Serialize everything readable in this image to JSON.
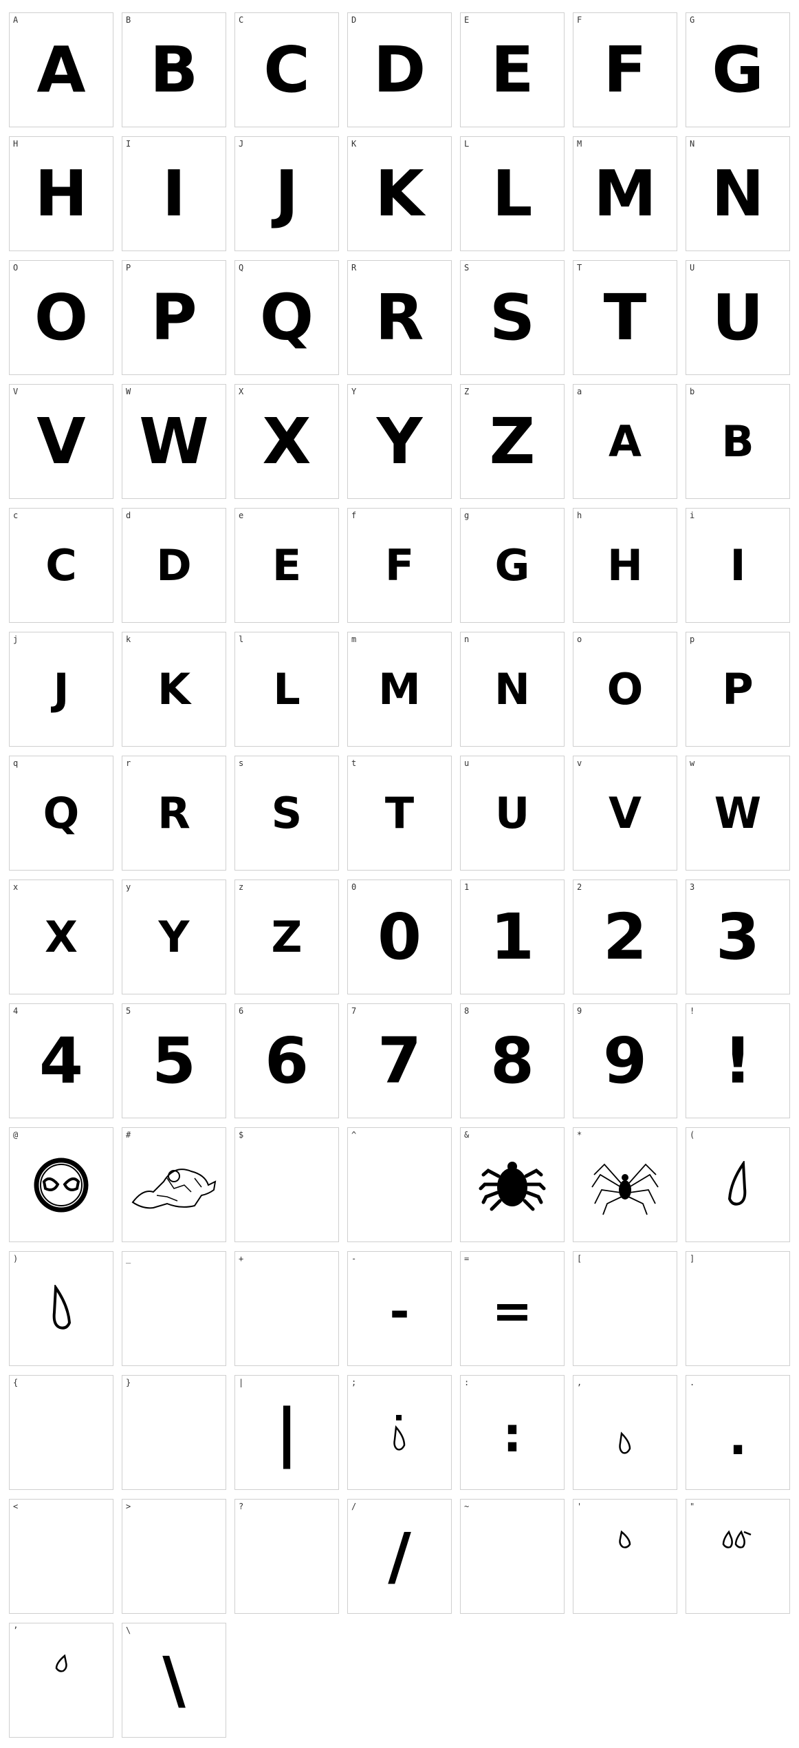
{
  "glyphs": [
    {
      "key": "A",
      "glyph": "A",
      "size": "big"
    },
    {
      "key": "B",
      "glyph": "B",
      "size": "big"
    },
    {
      "key": "C",
      "glyph": "C",
      "size": "big"
    },
    {
      "key": "D",
      "glyph": "D",
      "size": "big"
    },
    {
      "key": "E",
      "glyph": "E",
      "size": "big"
    },
    {
      "key": "F",
      "glyph": "F",
      "size": "big"
    },
    {
      "key": "G",
      "glyph": "G",
      "size": "big"
    },
    {
      "key": "H",
      "glyph": "H",
      "size": "big"
    },
    {
      "key": "I",
      "glyph": "I",
      "size": "big"
    },
    {
      "key": "J",
      "glyph": "J",
      "size": "big"
    },
    {
      "key": "K",
      "glyph": "K",
      "size": "big"
    },
    {
      "key": "L",
      "glyph": "L",
      "size": "big"
    },
    {
      "key": "M",
      "glyph": "M",
      "size": "big"
    },
    {
      "key": "N",
      "glyph": "N",
      "size": "big"
    },
    {
      "key": "O",
      "glyph": "O",
      "size": "big"
    },
    {
      "key": "P",
      "glyph": "P",
      "size": "big"
    },
    {
      "key": "Q",
      "glyph": "Q",
      "size": "big"
    },
    {
      "key": "R",
      "glyph": "R",
      "size": "big"
    },
    {
      "key": "S",
      "glyph": "S",
      "size": "big"
    },
    {
      "key": "T",
      "glyph": "T",
      "size": "big"
    },
    {
      "key": "U",
      "glyph": "U",
      "size": "big"
    },
    {
      "key": "V",
      "glyph": "V",
      "size": "big"
    },
    {
      "key": "W",
      "glyph": "W",
      "size": "big"
    },
    {
      "key": "X",
      "glyph": "X",
      "size": "big"
    },
    {
      "key": "Y",
      "glyph": "Y",
      "size": "big"
    },
    {
      "key": "Z",
      "glyph": "Z",
      "size": "big"
    },
    {
      "key": "a",
      "glyph": "A",
      "size": "small"
    },
    {
      "key": "b",
      "glyph": "B",
      "size": "small"
    },
    {
      "key": "c",
      "glyph": "C",
      "size": "small"
    },
    {
      "key": "d",
      "glyph": "D",
      "size": "small"
    },
    {
      "key": "e",
      "glyph": "E",
      "size": "small"
    },
    {
      "key": "f",
      "glyph": "F",
      "size": "small"
    },
    {
      "key": "g",
      "glyph": "G",
      "size": "small"
    },
    {
      "key": "h",
      "glyph": "H",
      "size": "small"
    },
    {
      "key": "i",
      "glyph": "I",
      "size": "small"
    },
    {
      "key": "j",
      "glyph": "J",
      "size": "small"
    },
    {
      "key": "k",
      "glyph": "K",
      "size": "small"
    },
    {
      "key": "l",
      "glyph": "L",
      "size": "small"
    },
    {
      "key": "m",
      "glyph": "M",
      "size": "small"
    },
    {
      "key": "n",
      "glyph": "N",
      "size": "small"
    },
    {
      "key": "o",
      "glyph": "O",
      "size": "small"
    },
    {
      "key": "p",
      "glyph": "P",
      "size": "small"
    },
    {
      "key": "q",
      "glyph": "Q",
      "size": "small"
    },
    {
      "key": "r",
      "glyph": "R",
      "size": "small"
    },
    {
      "key": "s",
      "glyph": "S",
      "size": "small"
    },
    {
      "key": "t",
      "glyph": "T",
      "size": "small"
    },
    {
      "key": "u",
      "glyph": "U",
      "size": "small"
    },
    {
      "key": "v",
      "glyph": "V",
      "size": "small"
    },
    {
      "key": "w",
      "glyph": "W",
      "size": "small"
    },
    {
      "key": "x",
      "glyph": "X",
      "size": "small"
    },
    {
      "key": "y",
      "glyph": "Y",
      "size": "small"
    },
    {
      "key": "z",
      "glyph": "Z",
      "size": "small"
    },
    {
      "key": "0",
      "glyph": "0",
      "size": "big"
    },
    {
      "key": "1",
      "glyph": "1",
      "size": "big"
    },
    {
      "key": "2",
      "glyph": "2",
      "size": "big"
    },
    {
      "key": "3",
      "glyph": "3",
      "size": "big"
    },
    {
      "key": "4",
      "glyph": "4",
      "size": "big"
    },
    {
      "key": "5",
      "glyph": "5",
      "size": "big"
    },
    {
      "key": "6",
      "glyph": "6",
      "size": "big"
    },
    {
      "key": "7",
      "glyph": "7",
      "size": "big"
    },
    {
      "key": "8",
      "glyph": "8",
      "size": "big"
    },
    {
      "key": "9",
      "glyph": "9",
      "size": "big"
    },
    {
      "key": "!",
      "glyph": "!",
      "size": "big"
    },
    {
      "key": "@",
      "glyph": "",
      "icon": "spider-mask-icon"
    },
    {
      "key": "#",
      "glyph": "",
      "icon": "crouching-figure-icon"
    },
    {
      "key": "$",
      "glyph": "",
      "icon": ""
    },
    {
      "key": "^",
      "glyph": "",
      "icon": ""
    },
    {
      "key": "&",
      "glyph": "",
      "icon": "beetle-spider-icon"
    },
    {
      "key": "*",
      "glyph": "",
      "icon": "spider-icon"
    },
    {
      "key": "(",
      "glyph": "",
      "icon": "left-fang-icon"
    },
    {
      "key": ")",
      "glyph": "",
      "icon": "right-fang-icon"
    },
    {
      "key": "_",
      "glyph": "",
      "icon": ""
    },
    {
      "key": "+",
      "glyph": "",
      "icon": ""
    },
    {
      "key": "-",
      "glyph": "-",
      "size": "sym"
    },
    {
      "key": "=",
      "glyph": "=",
      "size": "sym"
    },
    {
      "key": "[",
      "glyph": "",
      "icon": ""
    },
    {
      "key": "]",
      "glyph": "",
      "icon": ""
    },
    {
      "key": "{",
      "glyph": "",
      "icon": ""
    },
    {
      "key": "}",
      "glyph": "",
      "icon": ""
    },
    {
      "key": "|",
      "glyph": "|",
      "size": "big"
    },
    {
      "key": ";",
      "glyph": "",
      "icon": "semicolon-fang-icon"
    },
    {
      "key": ":",
      "glyph": ":",
      "size": "sym"
    },
    {
      "key": ",",
      "glyph": "",
      "icon": "comma-fang-icon"
    },
    {
      "key": ".",
      "glyph": ".",
      "size": "sym"
    },
    {
      "key": "<",
      "glyph": "",
      "icon": ""
    },
    {
      "key": ">",
      "glyph": "",
      "icon": ""
    },
    {
      "key": "?",
      "glyph": "",
      "icon": ""
    },
    {
      "key": "/",
      "glyph": "/",
      "size": "big"
    },
    {
      "key": "~",
      "glyph": "",
      "icon": ""
    },
    {
      "key": "'",
      "glyph": "",
      "icon": "apostrophe-fang-icon"
    },
    {
      "key": "\"",
      "glyph": "",
      "icon": "double-fang-icon"
    },
    {
      "key": "’",
      "glyph": "",
      "icon": "curly-apostrophe-fang-icon"
    },
    {
      "key": "\\",
      "glyph": "\\",
      "size": "big"
    }
  ]
}
